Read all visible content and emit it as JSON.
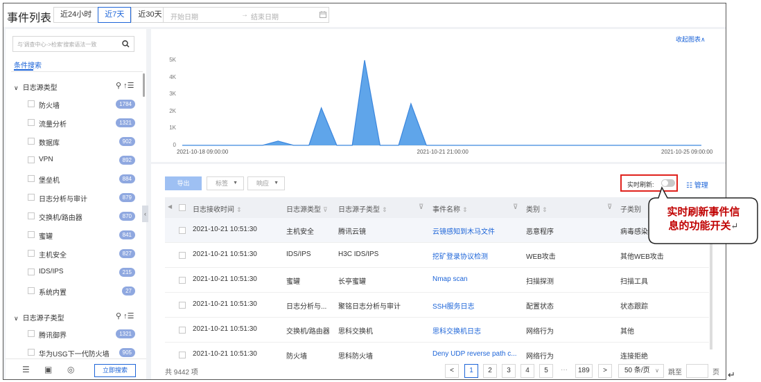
{
  "header": {
    "title": "事件列表",
    "range_tabs": [
      "近24小时",
      "近7天",
      "近30天"
    ],
    "active_tab": "近7天",
    "start_placeholder": "开始日期",
    "arrow": "→",
    "end_placeholder": "结束日期"
  },
  "sidebar": {
    "search_placeholder": "与'调查中心->检索'搜索语法一致",
    "condition_tab": "条件搜索",
    "group1": {
      "title": "日志源类型",
      "items": [
        {
          "label": "防火墙",
          "count": "1784"
        },
        {
          "label": "流量分析",
          "count": "1321"
        },
        {
          "label": "数据库",
          "count": "902"
        },
        {
          "label": "VPN",
          "count": "892"
        },
        {
          "label": "堡垒机",
          "count": "884"
        },
        {
          "label": "日志分析与审计",
          "count": "879"
        },
        {
          "label": "交换机/路由器",
          "count": "870"
        },
        {
          "label": "蜜罐",
          "count": "841"
        },
        {
          "label": "主机安全",
          "count": "827"
        },
        {
          "label": "IDS/IPS",
          "count": "215"
        },
        {
          "label": "系统内置",
          "count": "27"
        }
      ]
    },
    "group2": {
      "title": "日志源子类型",
      "items": [
        {
          "label": "腾讯御界",
          "count": "1321"
        },
        {
          "label": "华为USG下一代防火墙",
          "count": "905"
        }
      ]
    },
    "apply_label": "立即搜索"
  },
  "chart": {
    "collapse_label": "收起图表∧"
  },
  "chart_data": {
    "type": "area",
    "y_ticks": [
      "5K",
      "4K",
      "3K",
      "2K",
      "1K",
      "0"
    ],
    "x_ticks": [
      "2021-10-18 09:00:00",
      "2021-10-21 21:00:00",
      "2021-10-25 09:00:00"
    ],
    "ylim": [
      0,
      5000
    ],
    "color": "#4e9be8",
    "series": [
      {
        "values": [
          {
            "x": "2021-10-18 09:00:00",
            "y": 0
          },
          {
            "x": "2021-10-19 11:00:00",
            "y": 0
          },
          {
            "x": "2021-10-19 16:00:00",
            "y": 250
          },
          {
            "x": "2021-10-19 21:00:00",
            "y": 0
          },
          {
            "x": "2021-10-20 02:00:00",
            "y": 0
          },
          {
            "x": "2021-10-20 06:00:00",
            "y": 2200
          },
          {
            "x": "2021-10-20 11:00:00",
            "y": 0
          },
          {
            "x": "2021-10-20 16:00:00",
            "y": 0
          },
          {
            "x": "2021-10-20 20:00:00",
            "y": 5000
          },
          {
            "x": "2021-10-21 01:00:00",
            "y": 0
          },
          {
            "x": "2021-10-21 07:00:00",
            "y": 0
          },
          {
            "x": "2021-10-21 11:00:00",
            "y": 2450
          },
          {
            "x": "2021-10-21 16:00:00",
            "y": 0
          },
          {
            "x": "2021-10-25 09:00:00",
            "y": 0
          }
        ]
      }
    ]
  },
  "table": {
    "export_label": "导出",
    "tag_label": "标签",
    "respond_label": "响应",
    "live_refresh_label": "实时刷新:",
    "manage_label": "管理",
    "columns": [
      "日志接收时间",
      "日志源类型",
      "日志源子类型",
      "事件名称",
      "类别",
      "子类别"
    ],
    "rows": [
      {
        "time": "2021-10-21 10:51:30",
        "src": "主机安全",
        "sub": "腾讯云镜",
        "name": "云镜感知到木马文件",
        "cat": "恶意程序",
        "subcat": "病毒感染"
      },
      {
        "time": "2021-10-21 10:51:30",
        "src": "IDS/IPS",
        "sub": "H3C IDS/IPS",
        "name": "挖矿登录协议检测",
        "cat": "WEB攻击",
        "subcat": "其他WEB攻击"
      },
      {
        "time": "2021-10-21 10:51:30",
        "src": "蜜罐",
        "sub": "长亭蜜罐",
        "name": "Nmap scan",
        "cat": "扫描探测",
        "subcat": "扫描工具"
      },
      {
        "time": "2021-10-21 10:51:30",
        "src": "日志分析与...",
        "sub": "聚铭日志分析与审计",
        "name": "SSH服务日志",
        "cat": "配置状态",
        "subcat": "状态跟踪"
      },
      {
        "time": "2021-10-21 10:51:30",
        "src": "交换机/路由器",
        "sub": "思科交换机",
        "name": "思科交换机日志",
        "cat": "网络行为",
        "subcat": "其他"
      },
      {
        "time": "2021-10-21 10:51:30",
        "src": "防火墙",
        "sub": "思科防火墙",
        "name": "Deny UDP reverse path c...",
        "cat": "网络行为",
        "subcat": "连接拒绝"
      }
    ],
    "total_label": "共 9442 项",
    "pages": [
      "1",
      "2",
      "3",
      "4",
      "5"
    ],
    "ellipsis": "···",
    "last_page": "189",
    "prev": "<",
    "next": ">",
    "per_page": "50 条/页",
    "jump_label": "跳至",
    "page_label": "页"
  },
  "callout": {
    "line1": "实时刷新事件信",
    "line2": "息的功能开关",
    "mark": "↵"
  },
  "page_mark": "↵"
}
